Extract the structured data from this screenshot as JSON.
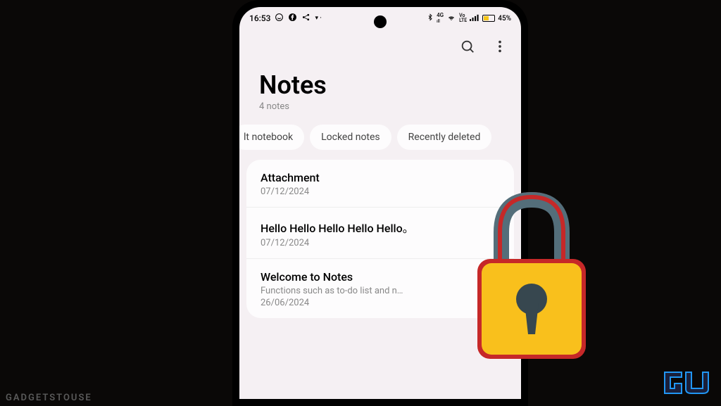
{
  "status_bar": {
    "time": "16:53",
    "bluetooth": "⁂",
    "network_label": "4G",
    "wifi": "wifi",
    "volte": "Vo LTE",
    "signal": "ııll",
    "battery_percent": "45%"
  },
  "header": {
    "title": "Notes",
    "count": "4 notes"
  },
  "tabs": [
    {
      "label": "lt notebook"
    },
    {
      "label": "Locked notes"
    },
    {
      "label": "Recently deleted"
    }
  ],
  "notes": [
    {
      "title": "Attachment",
      "preview": "",
      "date": "07/12/2024"
    },
    {
      "title": "Hello Hello Hello Hello Hello。",
      "preview": "",
      "date": "07/12/2024"
    },
    {
      "title": "Welcome to Notes",
      "preview": "Functions such as to-do list and n…",
      "date": "26/06/2024"
    }
  ],
  "watermark": "GADGETSTOUSE"
}
